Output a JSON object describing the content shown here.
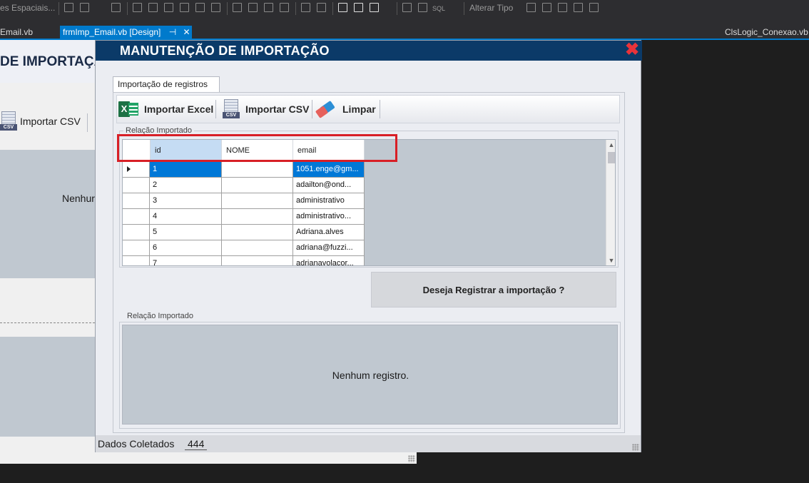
{
  "ide": {
    "toolbar_text_left": "es Espaciais...",
    "toolbar_text_type": "Alterar Tipo",
    "toolbar_text_sql": "SQL",
    "tabs": {
      "left": "Email.vb",
      "active": "frmImp_Email.vb [Design]",
      "pin": "⊣",
      "close": "✕",
      "right": "ClsLogic_Conexao.vb"
    }
  },
  "background_form": {
    "title": "DE IMPORTAÇÃ",
    "button_label": "Importar CSV",
    "empty_text": "Nenhur"
  },
  "window": {
    "title": "MANUTENÇÃO DE IMPORTAÇÃO",
    "close_glyph": "✖",
    "tab_label": "Importação de registros",
    "ribbon": {
      "excel_label": "Importar Excel",
      "csv_label": "Importar CSV",
      "csv_badge": "CSV",
      "clear_label": "Limpar",
      "excel_glyph": "X"
    },
    "group1_label": "Relação Importado",
    "grid": {
      "columns": [
        "id",
        "NOME",
        "email"
      ],
      "rows": [
        {
          "id": "1",
          "nome": "",
          "email": "1051.enge@gm..."
        },
        {
          "id": "2",
          "nome": "",
          "email": "adailton@ond..."
        },
        {
          "id": "3",
          "nome": "",
          "email": "administrativo"
        },
        {
          "id": "4",
          "nome": "",
          "email": "administrativo..."
        },
        {
          "id": "5",
          "nome": "",
          "email": "Adriana.alves"
        },
        {
          "id": "6",
          "nome": "",
          "email": "adriana@fuzzi..."
        },
        {
          "id": "7",
          "nome": "",
          "email": "adrianavolacor..."
        }
      ],
      "selected_row": 0,
      "scroll_up": "▲",
      "scroll_down": "▼"
    },
    "confirm_button": "Deseja Registrar a importação ?",
    "group2_label": "Relação Importado",
    "grid2_empty": "Nenhum registro.",
    "status": {
      "label": "Dados Coletados",
      "value": "444"
    }
  },
  "colors": {
    "title_bar": "#0b3a68",
    "selection": "#0078d7",
    "highlight_box": "#d81f26",
    "close": "#e8333a"
  }
}
